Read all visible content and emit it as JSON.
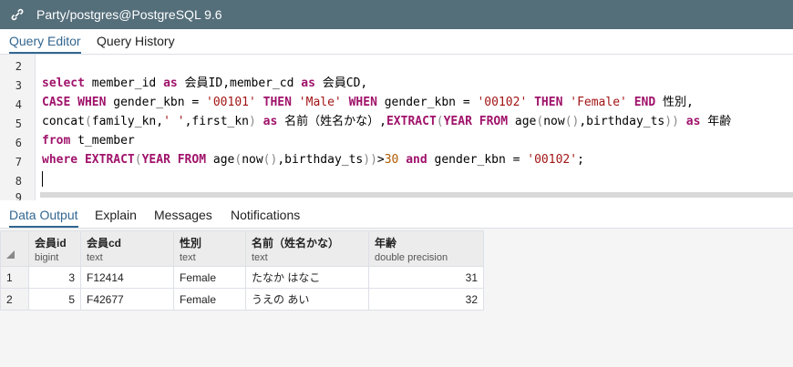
{
  "window": {
    "title": "Party/postgres@PostgreSQL 9.6",
    "accent": "#326690",
    "titlebar_bg": "#546e7a"
  },
  "editor_tabs": [
    {
      "label": "Query Editor",
      "active": true
    },
    {
      "label": "Query History",
      "active": false
    }
  ],
  "editor": {
    "line_numbers": [
      "2",
      "3",
      "4",
      "5",
      "6",
      "7",
      "8",
      "9"
    ]
  },
  "output_tabs": [
    {
      "label": "Data Output",
      "active": true
    },
    {
      "label": "Explain",
      "active": false
    },
    {
      "label": "Messages",
      "active": false
    },
    {
      "label": "Notifications",
      "active": false
    }
  ],
  "grid": {
    "columns": [
      {
        "name": "会員id",
        "type": "bigint"
      },
      {
        "name": "会員cd",
        "type": "text"
      },
      {
        "name": "性別",
        "type": "text"
      },
      {
        "name": "名前（姓名かな）",
        "type": "text"
      },
      {
        "name": "年齢",
        "type": "double precision"
      }
    ],
    "rows": [
      {
        "num": "1",
        "cells": [
          "3",
          "F12414",
          "Female",
          "たなか はなこ",
          "31"
        ]
      },
      {
        "num": "2",
        "cells": [
          "5",
          "F42677",
          "Female",
          "うえの あい",
          "32"
        ]
      }
    ]
  }
}
